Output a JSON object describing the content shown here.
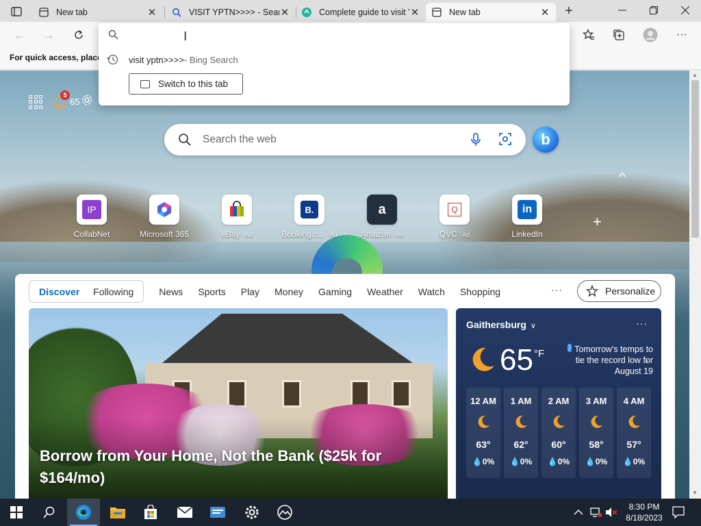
{
  "browser": {
    "tabs": [
      {
        "title": "New tab",
        "icon": "newtab-icon"
      },
      {
        "title": "VISIT YPTN>>>> - Search",
        "icon": "search-icon"
      },
      {
        "title": "Complete guide to visit YPTN",
        "icon": "site-icon"
      },
      {
        "title": "New tab",
        "icon": "newtab-icon"
      }
    ],
    "favorites_bar_text": "For quick access, place your favorites here on the favorites bar."
  },
  "omnibox": {
    "suggestion_text": "visit yptn>>>>",
    "suggestion_source": " - Bing Search",
    "switch_tab_label": "Switch to this tab"
  },
  "ntp": {
    "notification_count": "5",
    "header_temp": "65",
    "search_placeholder": "Search the web",
    "tiles": [
      {
        "label": "CollabNet",
        "ad": "",
        "icon": "IP",
        "color": "#7f3fbf"
      },
      {
        "label": "Microsoft 365",
        "ad": "",
        "icon": "m365-icon",
        "color": "#3b6fe0"
      },
      {
        "label": "eBay",
        "ad": " · Ad",
        "icon": "ebay-icon",
        "color": "#e53238"
      },
      {
        "label": "Booking.c...",
        "ad": " · Ad",
        "icon": "B.",
        "color": "#0c3b8c"
      },
      {
        "label": "Amazon",
        "ad": " · Ad",
        "icon": "a",
        "color": "#232f3e"
      },
      {
        "label": "QVC",
        "ad": " · Ad",
        "icon": "Q",
        "color": "#c43a3a"
      },
      {
        "label": "LinkedIn",
        "ad": "",
        "icon": "in",
        "color": "#0a66c2"
      }
    ]
  },
  "feed": {
    "segment": [
      "Discover",
      "Following"
    ],
    "nav": [
      "News",
      "Sports",
      "Play",
      "Money",
      "Gaming",
      "Weather",
      "Watch",
      "Shopping"
    ],
    "more": "···",
    "personalize_label": "Personalize",
    "hero_title": "Borrow from Your Home, Not the Bank ($25k for $164/mo)"
  },
  "weather": {
    "location": "Gaithersburg",
    "temp": "65",
    "unit": "°F",
    "note": "Tomorrow's temps to tie the record low for August 19",
    "hours": [
      {
        "time": "12 AM",
        "temp": "63°",
        "precip": "0%"
      },
      {
        "time": "1 AM",
        "temp": "62°",
        "precip": "0%"
      },
      {
        "time": "2 AM",
        "temp": "60°",
        "precip": "0%"
      },
      {
        "time": "3 AM",
        "temp": "58°",
        "precip": "0%"
      },
      {
        "time": "4 AM",
        "temp": "57°",
        "precip": "0%"
      }
    ]
  },
  "taskbar": {
    "time": "8:30 PM",
    "date": "8/18/2023"
  },
  "colors": {
    "accent": "#0f6cbd",
    "taskbar": "#1b2330",
    "weather_bg": "#243a66"
  }
}
